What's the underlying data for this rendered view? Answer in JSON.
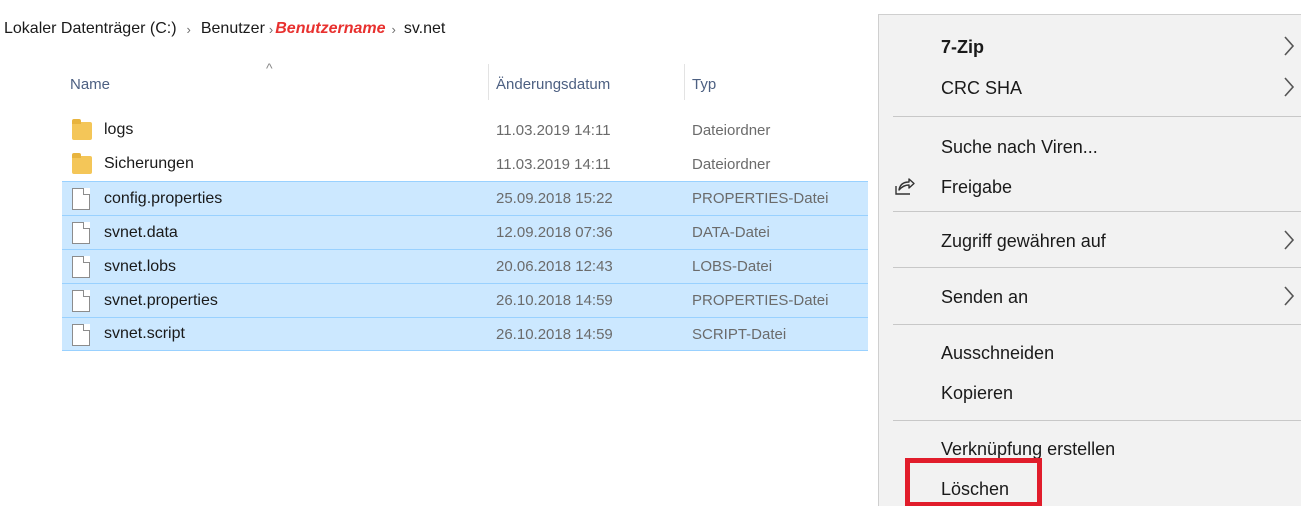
{
  "breadcrumb": {
    "items": [
      "Lokaler Datenträger (C:)",
      "Benutzer",
      "Benutzername",
      "sv.net"
    ],
    "separator": "›",
    "highlight_color": "#e8312f"
  },
  "file_list": {
    "columns": {
      "name": "Name",
      "date": "Änderungsdatum",
      "type": "Typ"
    },
    "sort_indicator": "^",
    "rows": [
      {
        "name": "logs",
        "date": "11.03.2019 14:11",
        "type": "Dateiordner",
        "icon": "folder-icon",
        "selected": false
      },
      {
        "name": "Sicherungen",
        "date": "11.03.2019 14:11",
        "type": "Dateiordner",
        "icon": "folder-icon",
        "selected": false
      },
      {
        "name": "config.properties",
        "date": "25.09.2018 15:22",
        "type": "PROPERTIES-Datei",
        "icon": "file-icon",
        "selected": true
      },
      {
        "name": "svnet.data",
        "date": "12.09.2018 07:36",
        "type": "DATA-Datei",
        "icon": "file-icon",
        "selected": true
      },
      {
        "name": "svnet.lobs",
        "date": "20.06.2018 12:43",
        "type": "LOBS-Datei",
        "icon": "file-icon",
        "selected": true
      },
      {
        "name": "svnet.properties",
        "date": "26.10.2018 14:59",
        "type": "PROPERTIES-Datei",
        "icon": "file-icon",
        "selected": true
      },
      {
        "name": "svnet.script",
        "date": "26.10.2018 14:59",
        "type": "SCRIPT-Datei",
        "icon": "file-icon",
        "selected": true
      }
    ],
    "selection_color": "#cce8ff"
  },
  "context_menu": {
    "items": [
      {
        "label": "7-Zip",
        "submenu": true,
        "bold": true
      },
      {
        "label": "CRC SHA",
        "submenu": true
      },
      {
        "label": "Suche nach Viren...",
        "submenu": false
      },
      {
        "label": "Freigabe",
        "submenu": false,
        "icon": "share-icon"
      },
      {
        "label": "Zugriff gewähren auf",
        "submenu": true
      },
      {
        "label": "Senden an",
        "submenu": true
      },
      {
        "label": "Ausschneiden",
        "submenu": false
      },
      {
        "label": "Kopieren",
        "submenu": false
      },
      {
        "label": "Verknüpfung erstellen",
        "submenu": false
      },
      {
        "label": "Löschen",
        "submenu": false,
        "highlighted": true
      }
    ],
    "highlight_color": "#e11d2b"
  }
}
